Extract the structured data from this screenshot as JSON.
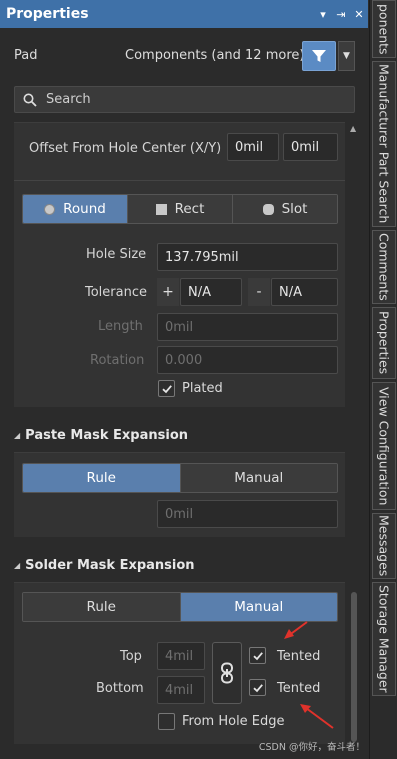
{
  "window": {
    "title": "Properties",
    "controls": [
      "▾",
      "⇥",
      "✕"
    ]
  },
  "side_tabs": [
    "ponents",
    "Manufacturer Part Search",
    "Comments",
    "Properties",
    "View Configuration",
    "Messages",
    "Storage Manager"
  ],
  "header": {
    "object_type": "Pad",
    "filter_summary": "Components (and 12 more)"
  },
  "search": {
    "placeholder": "Search"
  },
  "hole": {
    "offset_label": "Offset From Hole Center (X/Y)",
    "offset_x": "0mil",
    "offset_y": "0mil",
    "shape_options": [
      "Round",
      "Rect",
      "Slot"
    ],
    "shape_selected": "Round",
    "hole_size_label": "Hole Size",
    "hole_size": "137.795mil",
    "tolerance_label": "Tolerance",
    "tol_plus_sign": "+",
    "tol_plus": "N/A",
    "tol_minus_sign": "-",
    "tol_minus": "N/A",
    "length_label": "Length",
    "length": "0mil",
    "rotation_label": "Rotation",
    "rotation": "0.000",
    "plated_label": "Plated",
    "plated": true
  },
  "paste_mask": {
    "title": "Paste Mask Expansion",
    "options": [
      "Rule",
      "Manual"
    ],
    "selected": "Rule",
    "value": "0mil"
  },
  "solder_mask": {
    "title": "Solder Mask Expansion",
    "options": [
      "Rule",
      "Manual"
    ],
    "selected": "Manual",
    "top_label": "Top",
    "top_value": "4mil",
    "top_tented_label": "Tented",
    "top_tented": true,
    "bottom_label": "Bottom",
    "bottom_value": "4mil",
    "bottom_tented_label": "Tented",
    "bottom_tented": true,
    "from_hole_edge_label": "From Hole Edge",
    "from_hole_edge": false
  },
  "watermark": "CSDN @你好，奋斗者！",
  "colors": {
    "accent": "#5a7fad",
    "titlebar": "#3f71a8",
    "annotation_arrow": "#e0322b"
  }
}
